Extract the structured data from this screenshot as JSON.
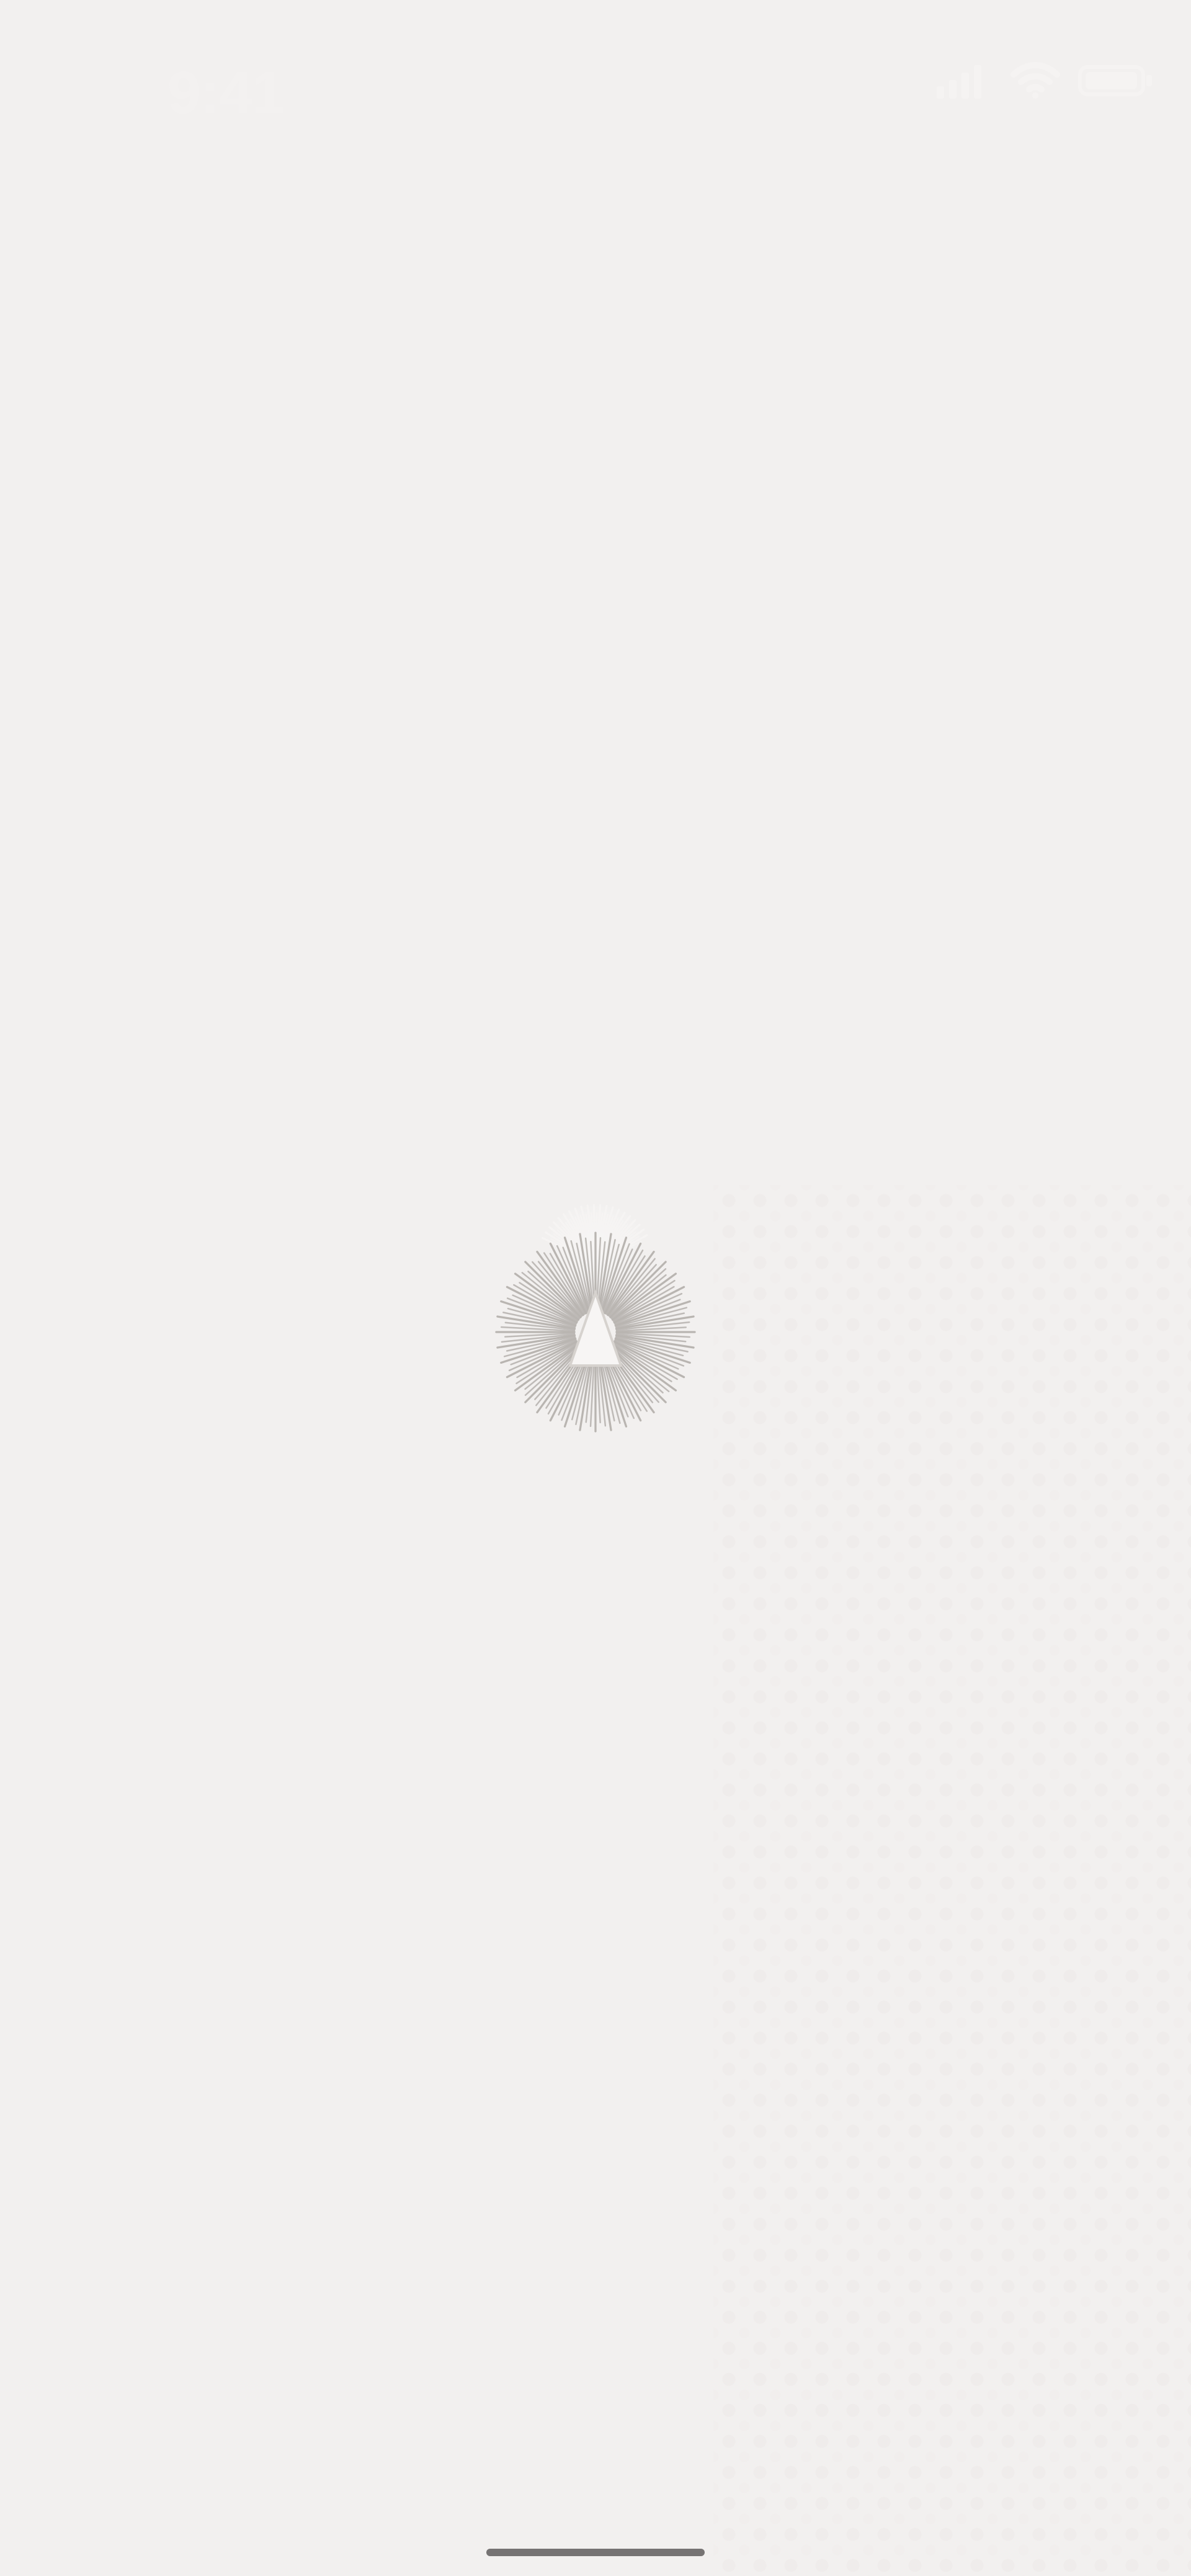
{
  "statusBar": {
    "time": "9:41",
    "icons": {
      "signal": "signal-icon",
      "wifi": "wifi-icon",
      "battery": "battery-icon"
    }
  },
  "splash": {
    "logo": {
      "icon": "sunburst-triangle-logo",
      "primary_color": "#b9b5b1",
      "light_color": "#f7f5f4"
    },
    "background_color": "#f2f0ef"
  },
  "homeIndicator": {
    "color": "#6f6c6b"
  }
}
